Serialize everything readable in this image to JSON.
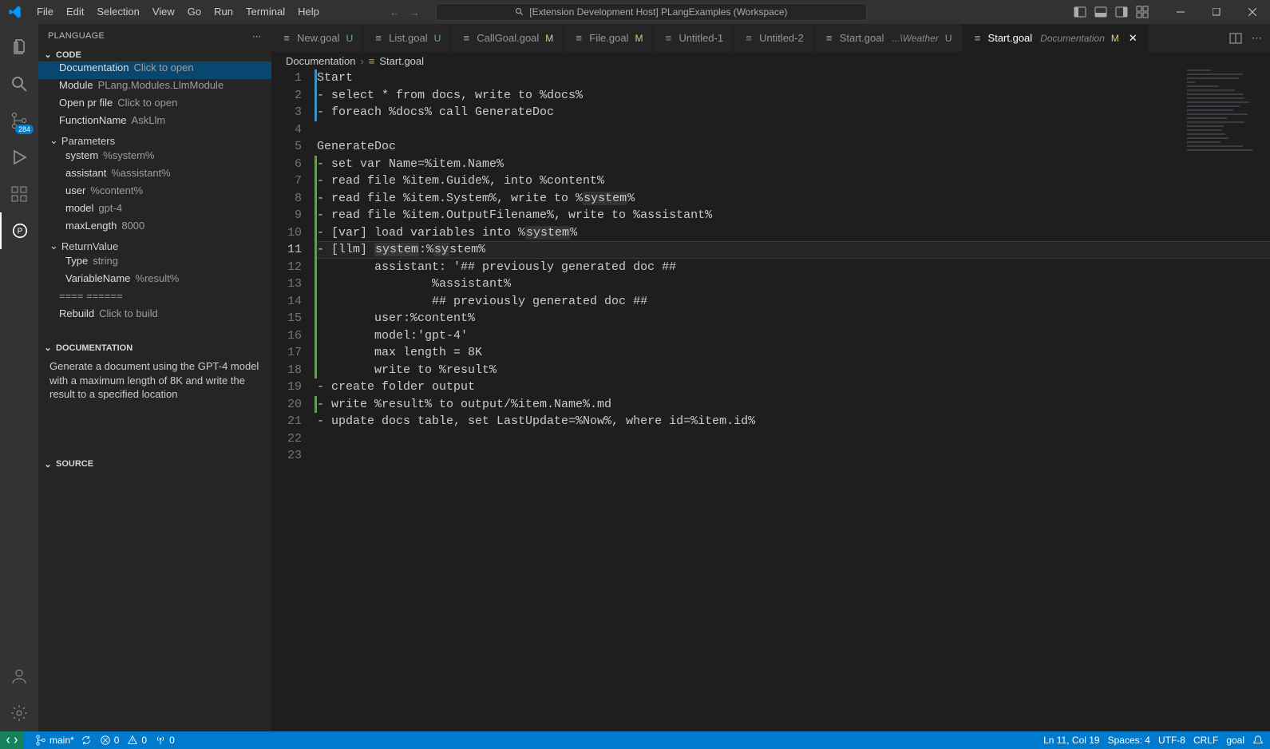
{
  "window": {
    "title": "[Extension Development Host] PLangExamples (Workspace)"
  },
  "menubar": [
    "File",
    "Edit",
    "Selection",
    "View",
    "Go",
    "Run",
    "Terminal",
    "Help"
  ],
  "activitybar": {
    "badge_scm": "284"
  },
  "sidebar": {
    "title": "PLANGUAGE",
    "sections": {
      "code": "CODE",
      "documentation": "DOCUMENTATION",
      "source": "SOURCE"
    },
    "tree": {
      "documentation": {
        "label": "Documentation",
        "value": "Click to open"
      },
      "module": {
        "label": "Module",
        "value": "PLang.Modules.LlmModule"
      },
      "openprfile": {
        "label": "Open pr file",
        "value": "Click to open"
      },
      "functionname": {
        "label": "FunctionName",
        "value": "AskLlm"
      },
      "parameters": "Parameters",
      "params": {
        "system": {
          "label": "system",
          "value": "%system%"
        },
        "assistant": {
          "label": "assistant",
          "value": "%assistant%"
        },
        "user": {
          "label": "user",
          "value": "%content%"
        },
        "model": {
          "label": "model",
          "value": "gpt-4"
        },
        "maxlength": {
          "label": "maxLength",
          "value": "8000"
        }
      },
      "returnvalue": "ReturnValue",
      "rv": {
        "type": {
          "label": "Type",
          "value": "string"
        },
        "varname": {
          "label": "VariableName",
          "value": "%result%"
        }
      },
      "divider": "==== ======",
      "rebuild": {
        "label": "Rebuild",
        "value": "Click to build"
      }
    },
    "doc_text": "Generate a document using the GPT-4 model with a maximum length of 8K and write the result to a specified location"
  },
  "tabs": [
    {
      "name": "New.goal",
      "state": "U"
    },
    {
      "name": "List.goal",
      "state": "U"
    },
    {
      "name": "CallGoal.goal",
      "state": "M"
    },
    {
      "name": "File.goal",
      "state": "M"
    },
    {
      "name": "Untitled-1",
      "state": ""
    },
    {
      "name": "Untitled-2",
      "state": ""
    },
    {
      "name": "Start.goal",
      "path": "...\\Weather",
      "state": "U"
    },
    {
      "name": "Start.goal",
      "path": "Documentation",
      "state": "M"
    }
  ],
  "breadcrumb": {
    "folder": "Documentation",
    "file": "Start.goal"
  },
  "code_lines": [
    "Start",
    "- select * from docs, write to %docs%",
    "- foreach %docs% call GenerateDoc",
    "",
    "GenerateDoc",
    "- set var Name=%item.Name%",
    "- read file %item.Guide%, into %content%",
    "- read file %item.System%, write to %system%",
    "- read file %item.OutputFilename%, write to %assistant%",
    "- [var] load variables into %system%",
    "- [llm] system:%system%",
    "        assistant: '## previously generated doc ##",
    "                %assistant%",
    "                ## previously generated doc ##",
    "        user:%content%",
    "        model:'gpt-4'",
    "        max length = 8K",
    "        write to %result%",
    "- create folder output",
    "- write %result% to output/%item.Name%.md",
    "- update docs table, set LastUpdate=%Now%, where id=%item.id%",
    "",
    ""
  ],
  "statusbar": {
    "branch": "main*",
    "errors": "0",
    "warnings": "0",
    "ports": "0",
    "position": "Ln 11, Col 19",
    "spaces": "Spaces: 4",
    "encoding": "UTF-8",
    "eol": "CRLF",
    "language": "goal"
  }
}
